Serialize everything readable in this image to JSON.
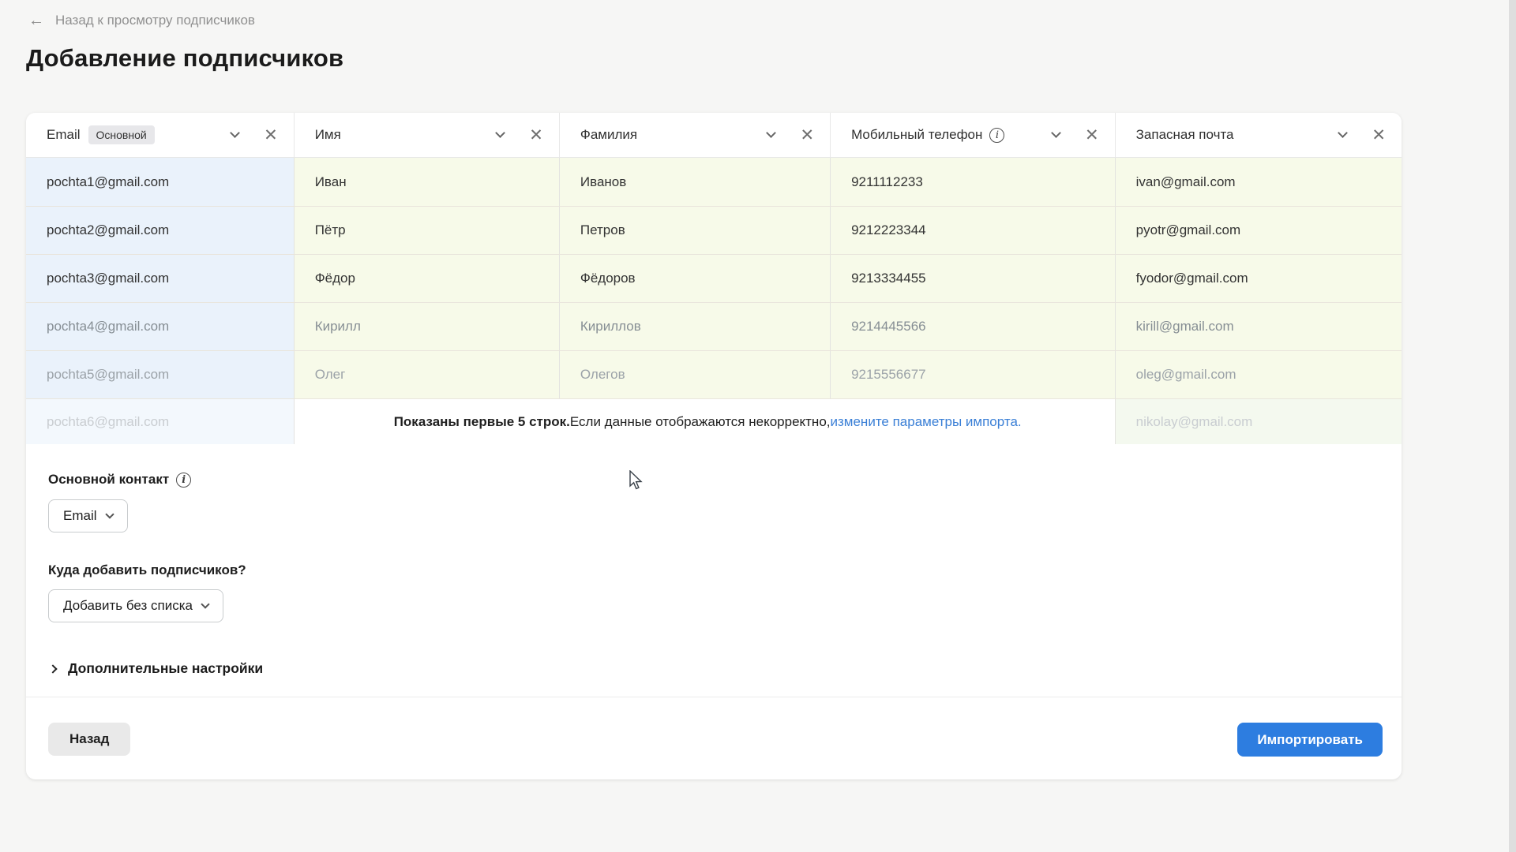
{
  "page": {
    "back_link": "Назад к просмотру подписчиков",
    "title": "Добавление подписчиков"
  },
  "table": {
    "columns": [
      {
        "label": "Email",
        "badge": "Основной",
        "has_info": false
      },
      {
        "label": "Имя",
        "badge": null,
        "has_info": false
      },
      {
        "label": "Фамилия",
        "badge": null,
        "has_info": false
      },
      {
        "label": "Мобильный телефон",
        "badge": null,
        "has_info": true
      },
      {
        "label": "Запасная почта",
        "badge": null,
        "has_info": false
      }
    ],
    "rows": [
      [
        "pochta1@gmail.com",
        "Иван",
        "Иванов",
        "9211112233",
        "ivan@gmail.com"
      ],
      [
        "pochta2@gmail.com",
        "Пётр",
        "Петров",
        "9212223344",
        "pyotr@gmail.com"
      ],
      [
        "pochta3@gmail.com",
        "Фёдор",
        "Фёдоров",
        "9213334455",
        "fyodor@gmail.com"
      ],
      [
        "pochta4@gmail.com",
        "Кирилл",
        "Кириллов",
        "9214445566",
        "kirill@gmail.com"
      ],
      [
        "pochta5@gmail.com",
        "Олег",
        "Олегов",
        "9215556677",
        "oleg@gmail.com"
      ]
    ],
    "last_row": {
      "email": "pochta6@gmail.com",
      "backup_email": "nikolay@gmail.com",
      "note_bold": "Показаны первые 5 строк.",
      "note_text": " Если данные отображаются некорректно, ",
      "note_link": "измените параметры импорта."
    }
  },
  "controls": {
    "primary_contact_label": "Основной контакт",
    "primary_contact_value": "Email",
    "add_to_label": "Куда добавить подписчиков?",
    "add_to_value": "Добавить без списка",
    "advanced_settings_label": "Дополнительные настройки",
    "info_icon_glyph": "i"
  },
  "footer": {
    "back_button": "Назад",
    "import_button": "Импортировать"
  },
  "colors": {
    "accent_blue": "#2d7de0",
    "link_blue": "#3a7fd6",
    "email_column_bg": "#eaf2fb",
    "data_column_bg": "#f7fae9",
    "badge_bg": "#e7e7ea",
    "page_bg": "#f6f6f5"
  }
}
